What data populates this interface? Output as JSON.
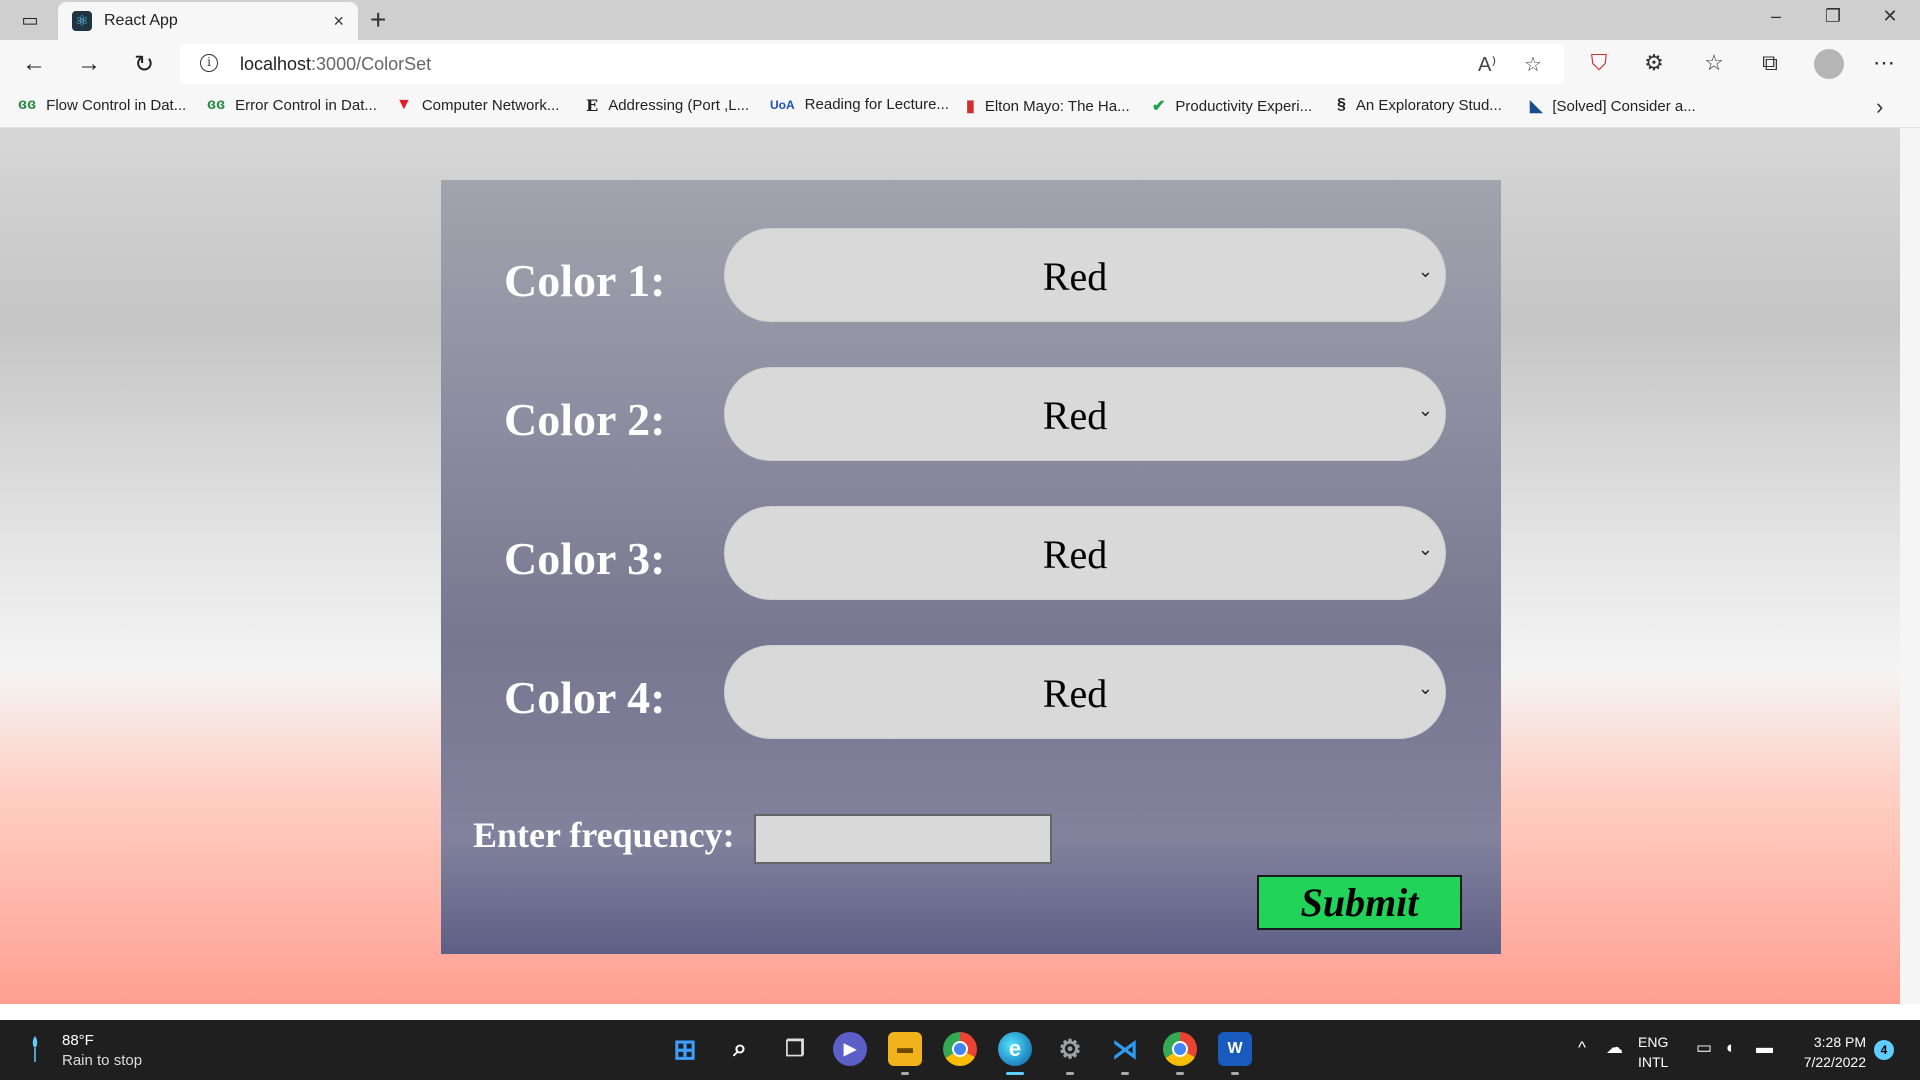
{
  "browser": {
    "tab": {
      "title": "React App",
      "close": "×",
      "favicon": "react-logo-icon"
    },
    "new_tab": "+",
    "window": {
      "minimize": "–",
      "restore": "❐",
      "close": "✕"
    },
    "url": {
      "host": "localhost",
      "path": ":3000/ColorSet"
    },
    "nav": {
      "back": "←",
      "forward": "→",
      "reload": "↻"
    },
    "bookmarks": [
      {
        "label": "Flow Control in Dat...",
        "icon": "geeksforgeeks-icon",
        "glyph": "ɞɞ",
        "color": "#2f8d46"
      },
      {
        "label": "Error Control in Dat...",
        "icon": "geeksforgeeks-icon",
        "glyph": "ɞɞ",
        "color": "#2f8d46"
      },
      {
        "label": "Computer Network...",
        "icon": "red-triangle-icon",
        "glyph": "▼",
        "color": "#e11d2a"
      },
      {
        "label": "Addressing (Port ,L...",
        "icon": "document-icon",
        "glyph": "E",
        "color": "#222222"
      },
      {
        "label": "Reading for Lecture...",
        "icon": "uofa-icon",
        "glyph": "UoA",
        "color": "#1e4fb3"
      },
      {
        "label": "Elton Mayo: The Ha...",
        "icon": "bookmark-red-icon",
        "glyph": "▮",
        "color": "#d32f2f"
      },
      {
        "label": "Productivity Experi...",
        "icon": "checkmark-icon",
        "glyph": "✔",
        "color": "#1aa34a"
      },
      {
        "label": "An Exploratory Stud...",
        "icon": "link-icon",
        "glyph": "§",
        "color": "#333333"
      },
      {
        "label": "[Solved] Consider a...",
        "icon": "coursehero-icon",
        "glyph": "◣",
        "color": "#1b4d8c"
      }
    ]
  },
  "form": {
    "colors": [
      {
        "label": "Color 1:",
        "value": "Red"
      },
      {
        "label": "Color 2:",
        "value": "Red"
      },
      {
        "label": "Color 3:",
        "value": "Red"
      },
      {
        "label": "Color 4:",
        "value": "Red"
      }
    ],
    "frequency_label": "Enter frequency:",
    "frequency_value": "",
    "submit_label": "Submit"
  },
  "taskbar": {
    "weather": {
      "temp": "88°F",
      "desc": "Rain to stop"
    },
    "language": {
      "line1": "ENG",
      "line2": "INTL"
    },
    "clock": {
      "time": "3:28 PM",
      "date": "7/22/2022"
    },
    "notifications": "4"
  },
  "colors": {
    "submit_bg": "#22d35a",
    "select_bg": "#d9d9d9",
    "label_text": "#ffffff"
  }
}
